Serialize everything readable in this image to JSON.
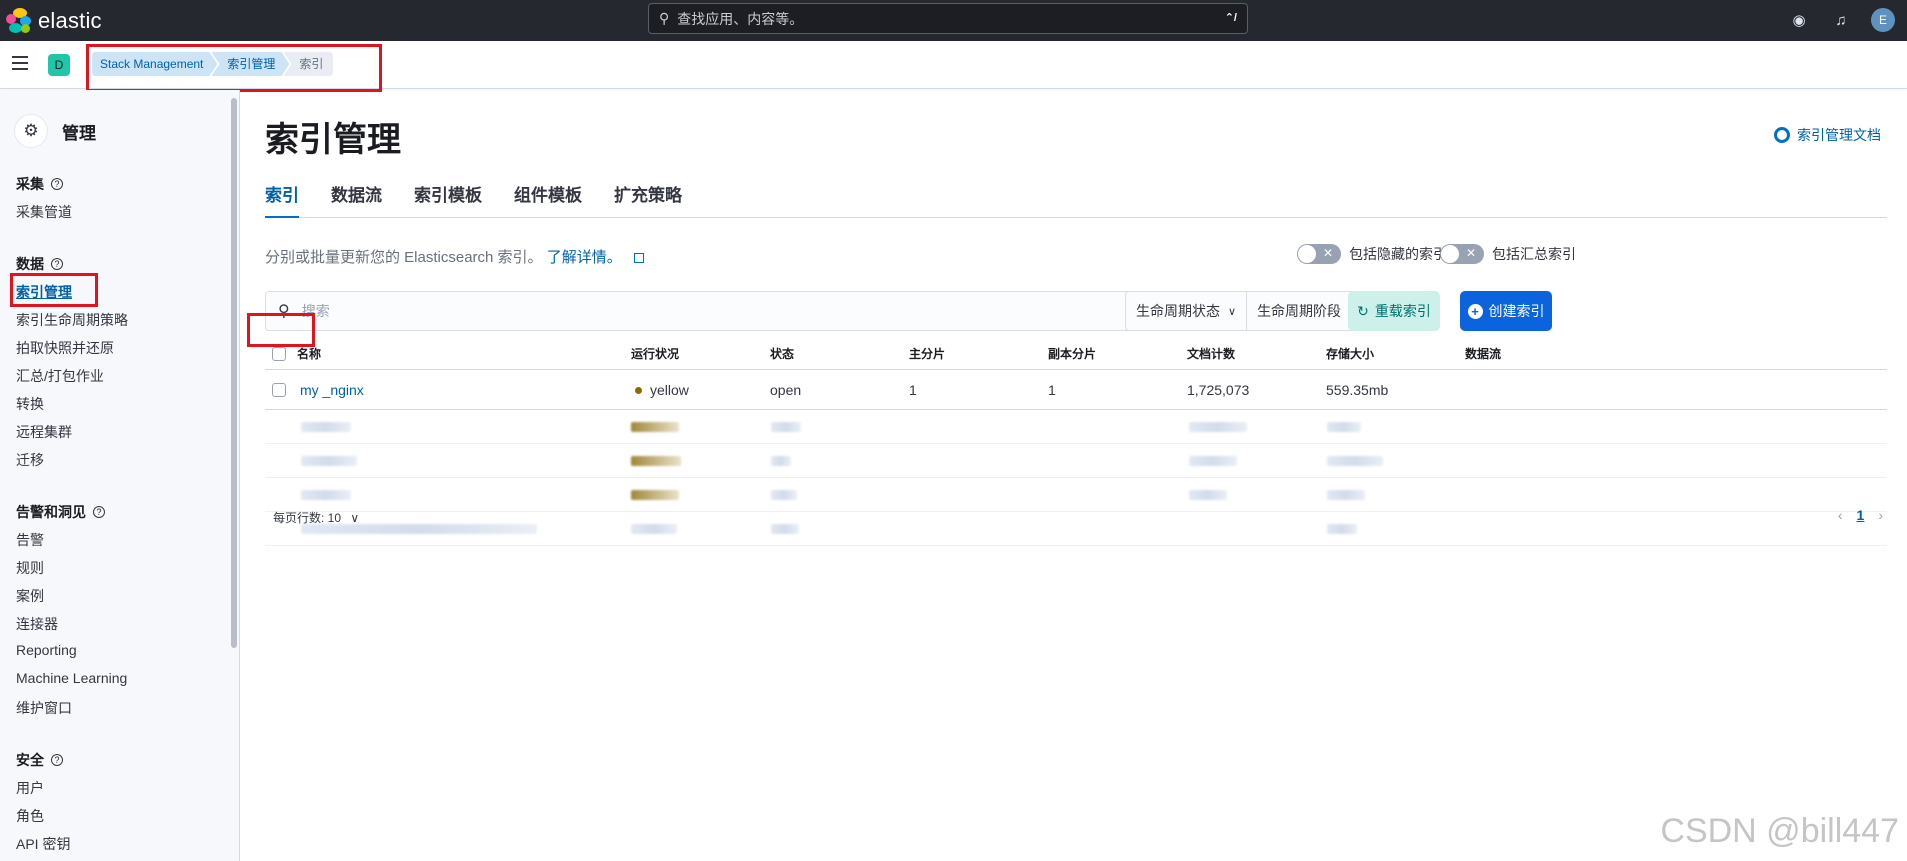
{
  "topbar": {
    "brand": "elastic",
    "search_placeholder": "查找应用、内容等。",
    "search_shortcut": "⌃/",
    "user_initial": "E"
  },
  "breadcrumbbar": {
    "space_initial": "D",
    "crumbs": [
      "Stack Management",
      "索引管理",
      "索引"
    ]
  },
  "sidebar": {
    "title": "管理",
    "groups": [
      {
        "label": "采集",
        "items": [
          "采集管道"
        ]
      },
      {
        "label": "数据",
        "items": [
          "索引管理",
          "索引生命周期策略",
          "拍取快照并还原",
          "汇总/打包作业",
          "转换",
          "远程集群",
          "迁移"
        ]
      },
      {
        "label": "告警和洞见",
        "items": [
          "告警",
          "规则",
          "案例",
          "连接器",
          "Reporting",
          "Machine Learning",
          "维护窗口"
        ]
      },
      {
        "label": "安全",
        "items": [
          "用户",
          "角色",
          "API 密钥"
        ]
      }
    ]
  },
  "main": {
    "title": "索引管理",
    "doc_link": "索引管理文档",
    "tabs": [
      "索引",
      "数据流",
      "索引模板",
      "组件模板",
      "扩充策略"
    ],
    "description": "分别或批量更新您的 Elasticsearch 索引。",
    "learn_more": "了解详情。",
    "toggle_hidden": "包括隐藏的索引",
    "toggle_rollup": "包括汇总索引",
    "search_placeholder": "搜索",
    "filter_lifecycle_status": "生命周期状态",
    "filter_lifecycle_phase": "生命周期阶段",
    "reload_button": "重载索引",
    "create_button": "创建索引",
    "columns": [
      "名称",
      "运行状况",
      "状态",
      "主分片",
      "副本分片",
      "文档计数",
      "存储大小",
      "数据流"
    ],
    "rows": [
      {
        "name": "my _nginx",
        "health": "yellow",
        "status": "open",
        "primary": "1",
        "replica": "1",
        "docs": "1,725,073",
        "size": "559.35mb",
        "data_stream": ""
      }
    ],
    "rows_per_page": "每页行数: 10",
    "current_page": "1"
  },
  "watermark": "CSDN @bill447",
  "colors": {
    "accent": "#0071c2",
    "topbar": "#25282f",
    "highlight_box": "#e0141e"
  }
}
